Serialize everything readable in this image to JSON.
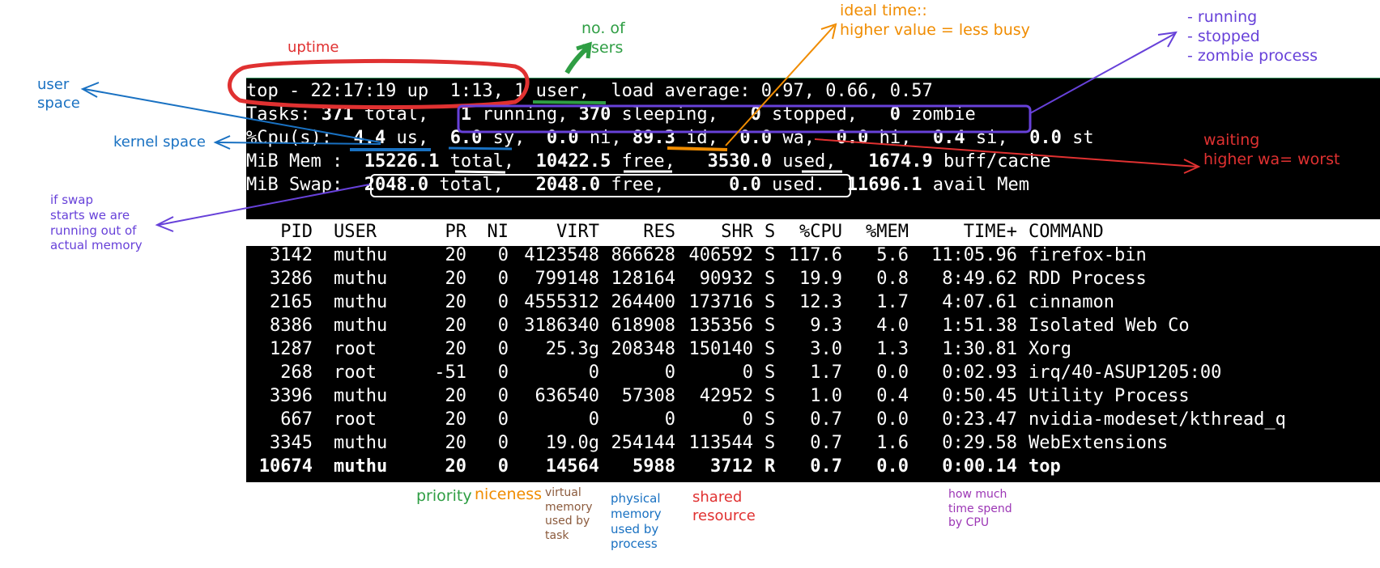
{
  "summary": {
    "line1": {
      "prefix": "top - 22:17:19 up  1:13, ",
      "users": "1 user,",
      "load": "  load average: 0.97, 0.66, 0.57"
    },
    "line2": {
      "label": "Tasks: ",
      "total": "371",
      "total_text": " total,   ",
      "running": "1",
      "running_text": " running, ",
      "sleeping": "370",
      "sleeping_text": " sleeping,   ",
      "stopped": "0",
      "stopped_text": " stopped,   ",
      "zombie": "0",
      "zombie_text": " zombie"
    },
    "line3": {
      "label": "%Cpu(s): ",
      "us": " 4.4",
      "us_text": " us,  ",
      "sy": "6.0",
      "sy_text": " sy,  ",
      "ni": "0.0",
      "ni_text": " ni, ",
      "id": "89.3",
      "id_text": " id,  ",
      "wa": "0.0",
      "wa_text": " wa,  ",
      "hi": "0.0",
      "hi_text": " hi,  ",
      "si": "0.4",
      "si_text": " si,  ",
      "st": "0.0",
      "st_text": " st"
    },
    "line4": {
      "label": "MiB Mem :  ",
      "total": "15226.1",
      "total_text": " total,  ",
      "free": "10422.5",
      "free_text": " free,   ",
      "used": "3530.0",
      "used_text": " used,   ",
      "buff": "1674.9",
      "buff_text": " buff/cache"
    },
    "line5": {
      "label": "MiB Swap:  ",
      "total": "2048.0",
      "total_text": " total,   ",
      "free": "2048.0",
      "free_text": " free,      ",
      "used": "0.0",
      "used_text": " used.  ",
      "avail": "11696.1",
      "avail_text": " avail Mem"
    }
  },
  "table": {
    "headers": [
      "PID",
      "USER",
      "PR",
      "NI",
      "VIRT",
      "RES",
      "SHR",
      "S",
      "%CPU",
      "%MEM",
      "TIME+",
      "COMMAND"
    ],
    "rows": [
      [
        "3142",
        "muthu",
        "20",
        "0",
        "4123548",
        "866628",
        "406592",
        "S",
        "117.6",
        "5.6",
        "11:05.96",
        "firefox-bin"
      ],
      [
        "3286",
        "muthu",
        "20",
        "0",
        "799148",
        "128164",
        "90932",
        "S",
        "19.9",
        "0.8",
        "8:49.62",
        "RDD Process"
      ],
      [
        "2165",
        "muthu",
        "20",
        "0",
        "4555312",
        "264400",
        "173716",
        "S",
        "12.3",
        "1.7",
        "4:07.61",
        "cinnamon"
      ],
      [
        "8386",
        "muthu",
        "20",
        "0",
        "3186340",
        "618908",
        "135356",
        "S",
        "9.3",
        "4.0",
        "1:51.38",
        "Isolated Web Co"
      ],
      [
        "1287",
        "root",
        "20",
        "0",
        "25.3g",
        "208348",
        "150140",
        "S",
        "3.0",
        "1.3",
        "1:30.81",
        "Xorg"
      ],
      [
        "268",
        "root",
        "-51",
        "0",
        "0",
        "0",
        "0",
        "S",
        "1.7",
        "0.0",
        "0:02.93",
        "irq/40-ASUP1205:00"
      ],
      [
        "3396",
        "muthu",
        "20",
        "0",
        "636540",
        "57308",
        "42952",
        "S",
        "1.0",
        "0.4",
        "0:50.45",
        "Utility Process"
      ],
      [
        "667",
        "root",
        "20",
        "0",
        "0",
        "0",
        "0",
        "S",
        "0.7",
        "0.0",
        "0:23.47",
        "nvidia-modeset/kthread_q"
      ],
      [
        "3345",
        "muthu",
        "20",
        "0",
        "19.0g",
        "254144",
        "113544",
        "S",
        "0.7",
        "1.6",
        "0:29.58",
        "WebExtensions"
      ],
      [
        "10674",
        "muthu",
        "20",
        "0",
        "14564",
        "5988",
        "3712",
        "R",
        "0.7",
        "0.0",
        "0:00.14",
        "top"
      ]
    ]
  },
  "annotations": {
    "uptime": "uptime",
    "users": "no. of\nusers",
    "ideal": "ideal time::\nhigher value = less busy",
    "states": "- running\n- stopped\n- zombie process",
    "user_space": "user\nspace",
    "kernel_space": "kernel space",
    "waiting": "waiting\nhigher wa= worst",
    "swap": "if swap\nstarts we are\nrunning out of\nactual memory",
    "priority": "priority",
    "niceness": "niceness",
    "virtual": "virtual\nmemory\nused by\ntask",
    "physical": "physical\nmemory\nused by\nprocess",
    "shared": "shared\nresource",
    "time": "how much\ntime spend\nby CPU"
  },
  "colors": {
    "red": "#e03131",
    "green": "#2f9e44",
    "orange": "#f08c00",
    "purple": "#6741d9",
    "blue": "#1971c2",
    "brown": "#8b5a3c"
  }
}
